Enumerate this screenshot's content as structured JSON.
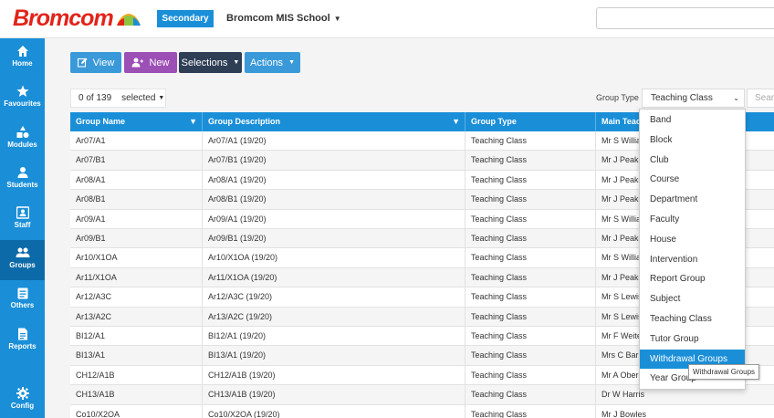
{
  "brand": {
    "name": "Bromcom",
    "badge": "Secondary",
    "school": "Bromcom MIS School",
    "accent": "#1a8fd8",
    "logo_red": "#e2231a"
  },
  "sidebar": {
    "items": [
      {
        "label": "Home",
        "icon": "home-icon"
      },
      {
        "label": "Favourites",
        "icon": "star-icon"
      },
      {
        "label": "Modules",
        "icon": "shapes-icon"
      },
      {
        "label": "Students",
        "icon": "person-icon"
      },
      {
        "label": "Staff",
        "icon": "staff-badge-icon"
      },
      {
        "label": "Groups",
        "icon": "people-icon",
        "active": true
      },
      {
        "label": "Others",
        "icon": "clipboard-icon"
      },
      {
        "label": "Reports",
        "icon": "document-icon"
      },
      {
        "label": "Config",
        "icon": "gear-icon"
      }
    ]
  },
  "toolbar": {
    "view_label": "View",
    "new_label": "New",
    "selections_label": "Selections",
    "actions_label": "Actions"
  },
  "selection": {
    "count_text": "0 of 139",
    "selected_label": "selected"
  },
  "filter": {
    "label": "Group Type",
    "value": "Teaching Class",
    "search_placeholder": "Search"
  },
  "table": {
    "columns": [
      "Group Name",
      "Group Description",
      "Group Type",
      "Main Teacher"
    ],
    "rows": [
      [
        "Ar07/A1",
        "Ar07/A1 (19/20)",
        "Teaching Class",
        "Mr S Williams"
      ],
      [
        "Ar07/B1",
        "Ar07/B1 (19/20)",
        "Teaching Class",
        "Mr J Peake"
      ],
      [
        "Ar08/A1",
        "Ar08/A1 (19/20)",
        "Teaching Class",
        "Mr J Peake"
      ],
      [
        "Ar08/B1",
        "Ar08/B1 (19/20)",
        "Teaching Class",
        "Mr J Peake"
      ],
      [
        "Ar09/A1",
        "Ar09/A1 (19/20)",
        "Teaching Class",
        "Mr S Williams"
      ],
      [
        "Ar09/B1",
        "Ar09/B1 (19/20)",
        "Teaching Class",
        "Mr J Peake"
      ],
      [
        "Ar10/X1OA",
        "Ar10/X1OA (19/20)",
        "Teaching Class",
        "Mr S Williams"
      ],
      [
        "Ar11/X1OA",
        "Ar11/X1OA (19/20)",
        "Teaching Class",
        "Mr J Peake"
      ],
      [
        "Ar12/A3C",
        "Ar12/A3C (19/20)",
        "Teaching Class",
        "Mr S Lewis"
      ],
      [
        "Ar13/A2C",
        "Ar13/A2C (19/20)",
        "Teaching Class",
        "Mr S Lewis"
      ],
      [
        "BI12/A1",
        "BI12/A1 (19/20)",
        "Teaching Class",
        "Mr F Weiteman"
      ],
      [
        "BI13/A1",
        "BI13/A1 (19/20)",
        "Teaching Class",
        "Mrs C Barrett"
      ],
      [
        "CH12/A1B",
        "CH12/A1B (19/20)",
        "Teaching Class",
        "Mr A Oberon"
      ],
      [
        "CH13/A1B",
        "CH13/A1B (19/20)",
        "Teaching Class",
        "Dr W Harris"
      ],
      [
        "Co10/X2OA",
        "Co10/X2OA (19/20)",
        "Teaching Class",
        "Mr J Bowles"
      ]
    ]
  },
  "dropdown": {
    "options": [
      "Band",
      "Block",
      "Club",
      "Course",
      "Department",
      "Faculty",
      "House",
      "Intervention",
      "Report Group",
      "Subject",
      "Teaching Class",
      "Tutor Group",
      "Withdrawal Groups",
      "Year Group"
    ],
    "highlighted": "Withdrawal Groups",
    "tooltip": "Withdrawal Groups"
  }
}
